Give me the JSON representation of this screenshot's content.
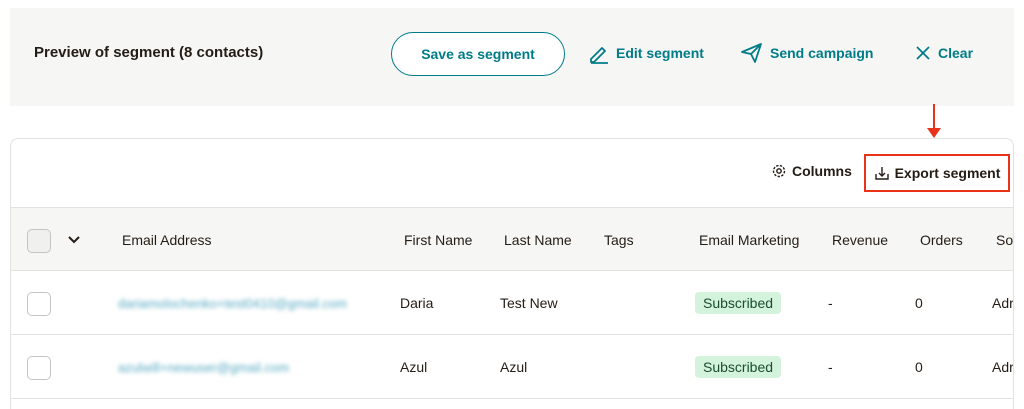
{
  "preview": {
    "title": "Preview of segment (8 contacts)",
    "save_label": "Save as segment",
    "edit_label": "Edit segment",
    "send_label": "Send campaign",
    "clear_label": "Clear"
  },
  "toolbar": {
    "columns_label": "Columns",
    "export_label": "Export segment"
  },
  "table": {
    "headers": [
      "Email Address",
      "First Name",
      "Last Name",
      "Tags",
      "Email Marketing",
      "Revenue",
      "Orders",
      "So"
    ],
    "rows": [
      {
        "email": "dariamolochenko+test0410@gmail.com",
        "first_name": "Daria",
        "last_name": "Test New",
        "tags": "",
        "email_marketing": "Subscribed",
        "revenue": "-",
        "orders": "0",
        "source": "Adr"
      },
      {
        "email": "azulwill+newuser@gmail.com",
        "first_name": "Azul",
        "last_name": "Azul",
        "tags": "",
        "email_marketing": "Subscribed",
        "revenue": "-",
        "orders": "0",
        "source": "Adr"
      }
    ]
  },
  "colors": {
    "accent": "#007c89",
    "highlight": "#e8321a",
    "badge_bg": "#d4f3dd",
    "panel_bg": "#f6f6f4"
  },
  "icons": [
    "pencil-icon",
    "paper-plane-icon",
    "close-icon",
    "gear-icon",
    "download-icon",
    "chevron-down-icon",
    "annotation-arrow"
  ]
}
